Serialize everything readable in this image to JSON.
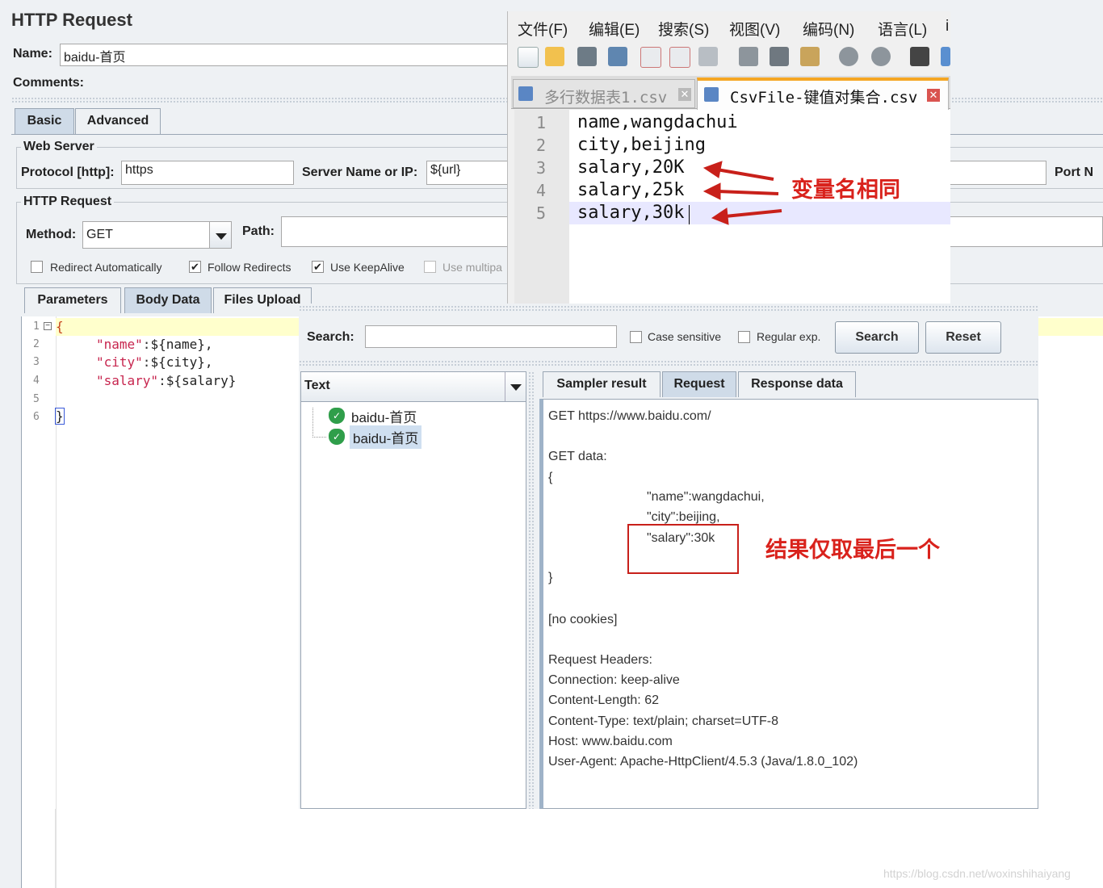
{
  "http_request": {
    "title": "HTTP Request",
    "name_label": "Name:",
    "name_value": "baidu-首页",
    "comments_label": "Comments:",
    "tabs": [
      "Basic",
      "Advanced"
    ],
    "web_server": {
      "legend": "Web Server",
      "protocol_label": "Protocol [http]:",
      "protocol_value": "https",
      "server_label": "Server Name or IP:",
      "server_value": "${url}",
      "port_label": "Port N"
    },
    "http_group": {
      "legend": "HTTP Request",
      "method_label": "Method:",
      "method_value": "GET",
      "path_label": "Path:"
    },
    "options": [
      {
        "label": "Redirect Automatically",
        "checked": false
      },
      {
        "label": "Follow Redirects",
        "checked": true
      },
      {
        "label": "Use KeepAlive",
        "checked": true
      },
      {
        "label": "Use multipa",
        "checked": false
      }
    ],
    "sub_tabs": [
      "Parameters",
      "Body Data",
      "Files Upload"
    ],
    "body": {
      "line_numbers": [
        "1",
        "2",
        "3",
        "4",
        "5",
        "6"
      ],
      "brace_open": "{",
      "lines": [
        {
          "key": "\"name\"",
          "colon": ":",
          "var": "${name}",
          "comma": ","
        },
        {
          "key": "\"city\"",
          "colon": ":",
          "var": "${city}",
          "comma": ","
        },
        {
          "key": "\"salary\"",
          "colon": ":",
          "var": "${salary}",
          "comma": ""
        }
      ],
      "brace_close": "}"
    }
  },
  "editor": {
    "menu": [
      "文件(F)",
      "编辑(E)",
      "搜索(S)",
      "视图(V)",
      "编码(N)",
      "语言(L)",
      "i"
    ],
    "tabs": [
      {
        "label": "多行数据表1.csv",
        "active": false
      },
      {
        "label": "CsvFile-键值对集合.csv",
        "active": true
      }
    ],
    "line_numbers": [
      "1",
      "2",
      "3",
      "4",
      "5"
    ],
    "lines": [
      "name,wangdachui",
      "city,beijing",
      "salary,20K",
      "salary,25k",
      "salary,30k"
    ],
    "annotation": "变量名相同",
    "annotation_color": "#d9221c"
  },
  "results": {
    "search_label": "Search:",
    "search_value": "",
    "case_sensitive": "Case sensitive",
    "regular_exp": "Regular exp.",
    "search_button": "Search",
    "reset_button": "Reset",
    "tree_header": "Text",
    "tree_items": [
      "baidu-首页",
      "baidu-首页"
    ],
    "tabs": [
      "Sampler result",
      "Request",
      "Response data"
    ],
    "request_lines": {
      "url": "GET https://www.baidu.com/",
      "get_data": "GET data:",
      "brace_open": "{",
      "name": "\"name\":wangdachui,",
      "city": "\"city\":beijing,",
      "salary": "\"salary\":30k",
      "brace_close": "}",
      "no_cookies": "[no cookies]",
      "headers_title": "Request Headers:",
      "headers": [
        "Connection: keep-alive",
        "Content-Length: 62",
        "Content-Type: text/plain; charset=UTF-8",
        "Host: www.baidu.com",
        "User-Agent: Apache-HttpClient/4.5.3 (Java/1.8.0_102)"
      ]
    },
    "annotation": "结果仅取最后一个"
  },
  "watermark": "https://blog.csdn.net/woxinshihaiyang",
  "colors": {
    "panel_bg": "#eef1f4",
    "highlight_yellow": "#ffffcc",
    "selection_blue": "#cfdff0",
    "json_key": "#c7254e",
    "annotation_red": "#d9221c"
  }
}
